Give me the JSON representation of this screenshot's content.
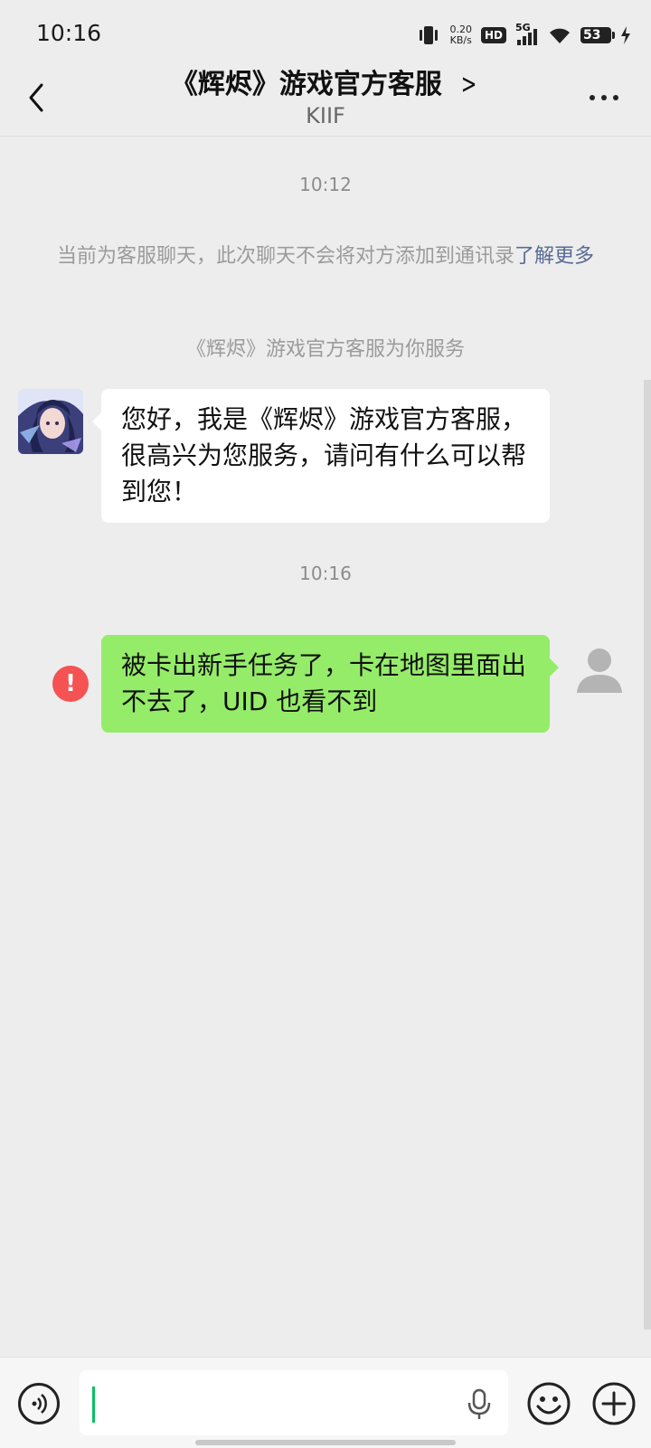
{
  "status_bar": {
    "time": "10:16",
    "net_speed_value": "0.20",
    "net_speed_unit": "KB/s",
    "hd_label": "HD",
    "network_label": "5G",
    "battery_level": "53",
    "icons": [
      "vibrate-icon",
      "hd-icon",
      "signal-5g-icon",
      "wifi-icon",
      "battery-icon",
      "charging-icon"
    ]
  },
  "header": {
    "title": "《辉烬》游戏官方客服",
    "subtitle": "KIIF"
  },
  "chat": {
    "timestamp_1": "10:12",
    "system_note": "当前为客服聊天，此次聊天不会将对方添加到通讯录",
    "system_note_link": "了解更多",
    "service_intro": "《辉烬》游戏官方客服为你服务",
    "messages": [
      {
        "side": "incoming",
        "text": "您好，我是《辉烬》游戏官方客服，很高兴为您服务，请问有什么可以帮到您！"
      }
    ],
    "timestamp_2": "10:16",
    "outgoing": {
      "text": "被卡出新手任务了，卡在地图里面出不去了，UID 也看不到",
      "error_mark": "!",
      "status": "failed"
    }
  },
  "colors": {
    "background": "#ededed",
    "incoming_bubble": "#ffffff",
    "outgoing_bubble": "#95ec69",
    "error": "#f55253",
    "link": "#576b95",
    "caret": "#07c160"
  }
}
